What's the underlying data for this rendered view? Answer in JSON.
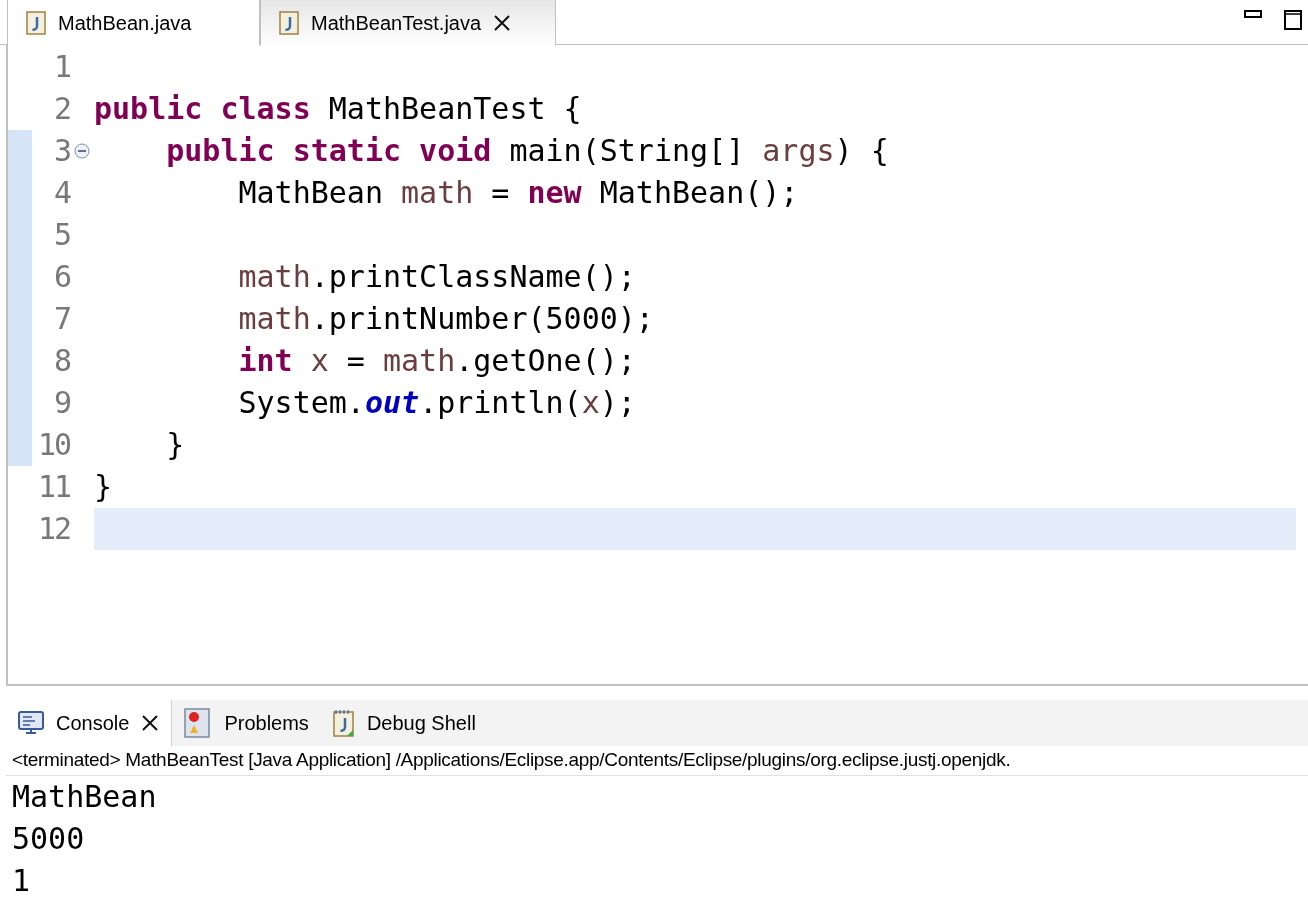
{
  "editor_tabs": [
    {
      "label": "MathBean.java",
      "selected": false,
      "closable": false
    },
    {
      "label": "MathBeanTest.java",
      "selected": true,
      "closable": true
    }
  ],
  "editor": {
    "lines": [
      {
        "number": "1",
        "fold": false,
        "range_marker": false,
        "current": false
      },
      {
        "number": "2",
        "fold": false,
        "range_marker": false,
        "current": false,
        "tokens": [
          {
            "text": "public class",
            "kind": "keyword"
          },
          {
            "text": " MathBeanTest {",
            "kind": "plain"
          }
        ]
      },
      {
        "number": "3",
        "fold": true,
        "range_marker": true,
        "current": false,
        "tokens": [
          {
            "text": "    public static void",
            "kind": "keyword"
          },
          {
            "text": " main(String[] ",
            "kind": "plain"
          },
          {
            "text": "args",
            "kind": "local"
          },
          {
            "text": ") {",
            "kind": "plain"
          }
        ]
      },
      {
        "number": "4",
        "fold": false,
        "range_marker": true,
        "current": false,
        "tokens": [
          {
            "text": "        MathBean ",
            "kind": "plain"
          },
          {
            "text": "math",
            "kind": "local"
          },
          {
            "text": " = ",
            "kind": "plain"
          },
          {
            "text": "new",
            "kind": "keyword"
          },
          {
            "text": " MathBean();",
            "kind": "plain"
          }
        ]
      },
      {
        "number": "5",
        "fold": false,
        "range_marker": true,
        "current": false
      },
      {
        "number": "6",
        "fold": false,
        "range_marker": true,
        "current": false,
        "tokens": [
          {
            "text": "        math",
            "kind": "local"
          },
          {
            "text": ".printClassName();",
            "kind": "plain"
          }
        ]
      },
      {
        "number": "7",
        "fold": false,
        "range_marker": true,
        "current": false,
        "tokens": [
          {
            "text": "        math",
            "kind": "local"
          },
          {
            "text": ".printNumber(5000);",
            "kind": "plain"
          }
        ]
      },
      {
        "number": "8",
        "fold": false,
        "range_marker": true,
        "current": false,
        "tokens": [
          {
            "text": "        int",
            "kind": "keyword"
          },
          {
            "text": " x",
            "kind": "local"
          },
          {
            "text": " = ",
            "kind": "plain"
          },
          {
            "text": "math",
            "kind": "local"
          },
          {
            "text": ".getOne();",
            "kind": "plain"
          }
        ]
      },
      {
        "number": "9",
        "fold": false,
        "range_marker": true,
        "current": false,
        "tokens": [
          {
            "text": "        System.",
            "kind": "plain"
          },
          {
            "text": "out",
            "kind": "static_field"
          },
          {
            "text": ".println(",
            "kind": "plain"
          },
          {
            "text": "x",
            "kind": "local"
          },
          {
            "text": ");",
            "kind": "plain"
          }
        ]
      },
      {
        "number": "10",
        "fold": false,
        "range_marker": true,
        "current": false,
        "tokens": [
          {
            "text": "    }",
            "kind": "plain"
          }
        ]
      },
      {
        "number": "11",
        "fold": false,
        "range_marker": false,
        "current": false,
        "tokens": [
          {
            "text": "}",
            "kind": "plain"
          }
        ]
      },
      {
        "number": "12",
        "fold": false,
        "range_marker": false,
        "current": true
      }
    ]
  },
  "panel_tabs": [
    {
      "label": "Console",
      "kind": "console",
      "selected": true,
      "closable": true
    },
    {
      "label": "Problems",
      "kind": "problems",
      "selected": false,
      "closable": false
    },
    {
      "label": "Debug Shell",
      "kind": "debug",
      "selected": false,
      "closable": false
    }
  ],
  "console": {
    "header": "<terminated> MathBeanTest [Java Application] /Applications/Eclipse.app/Contents/Eclipse/plugins/org.eclipse.justj.openjdk.",
    "output": [
      "MathBean",
      "5000",
      "1"
    ]
  }
}
